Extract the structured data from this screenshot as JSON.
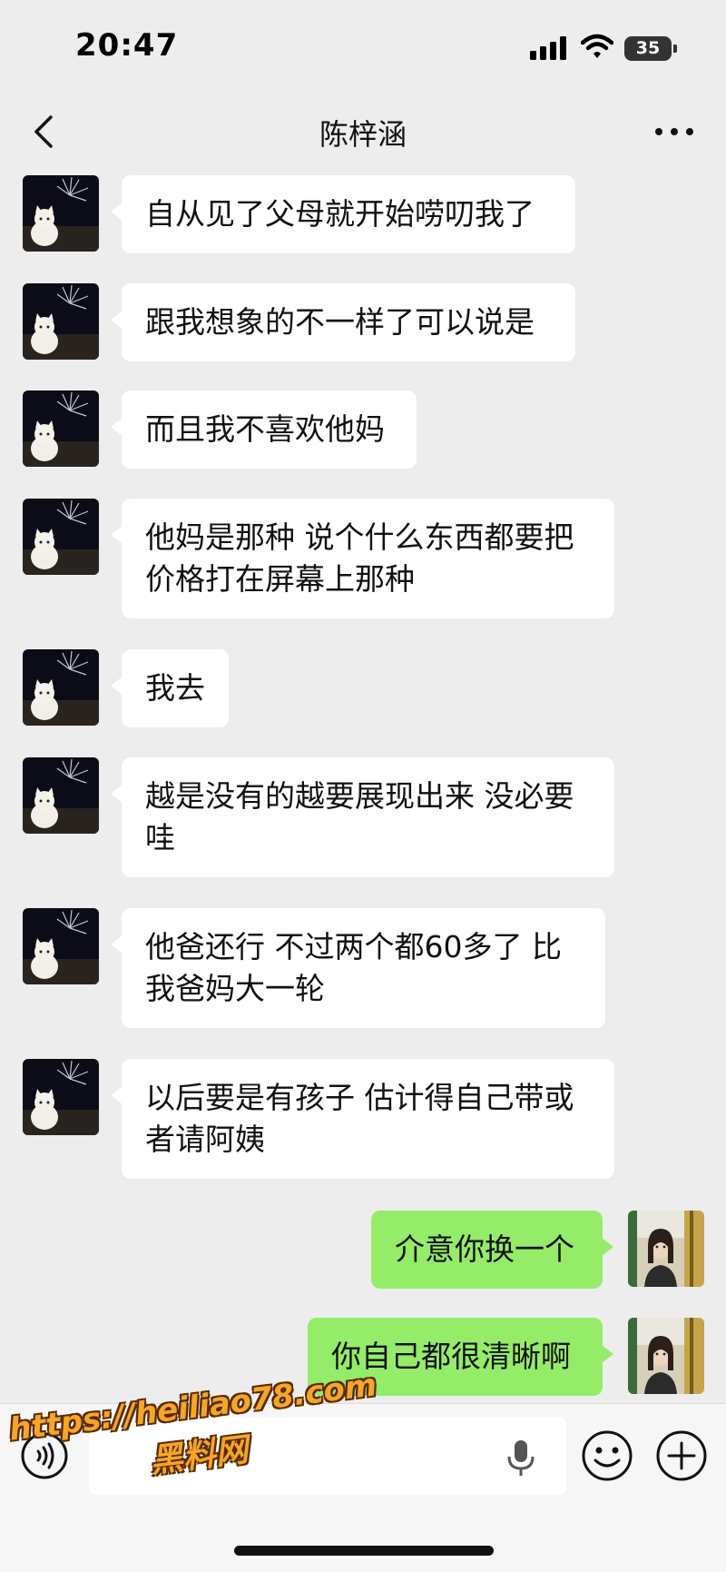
{
  "status_bar": {
    "time": "20:47",
    "battery": "35"
  },
  "header": {
    "title": "陈梓涵"
  },
  "messages": [
    {
      "side": "in",
      "text": "自从见了父母就开始唠叨我了"
    },
    {
      "side": "in",
      "text": "跟我想象的不一样了可以说是"
    },
    {
      "side": "in",
      "text": "而且我不喜欢他妈"
    },
    {
      "side": "in",
      "text": "他妈是那种 说个什么东西都要把价格打在屏幕上那种"
    },
    {
      "side": "in",
      "text": "我去"
    },
    {
      "side": "in",
      "text": "越是没有的越要展现出来 没必要哇"
    },
    {
      "side": "in",
      "text": "他爸还行 不过两个都60多了 比我爸妈大一轮"
    },
    {
      "side": "in",
      "text": "以后要是有孩子 估计得自己带或者请阿姨"
    },
    {
      "side": "out",
      "text": "介意你换一个"
    },
    {
      "side": "out",
      "text": "你自己都很清晰啊"
    }
  ],
  "input": {
    "value": ""
  },
  "watermark": {
    "url": "https://heiliao78.com",
    "name": "黑料网"
  },
  "colors": {
    "background": "#ededed",
    "incoming_bubble": "#ffffff",
    "outgoing_bubble": "#95ec69"
  }
}
